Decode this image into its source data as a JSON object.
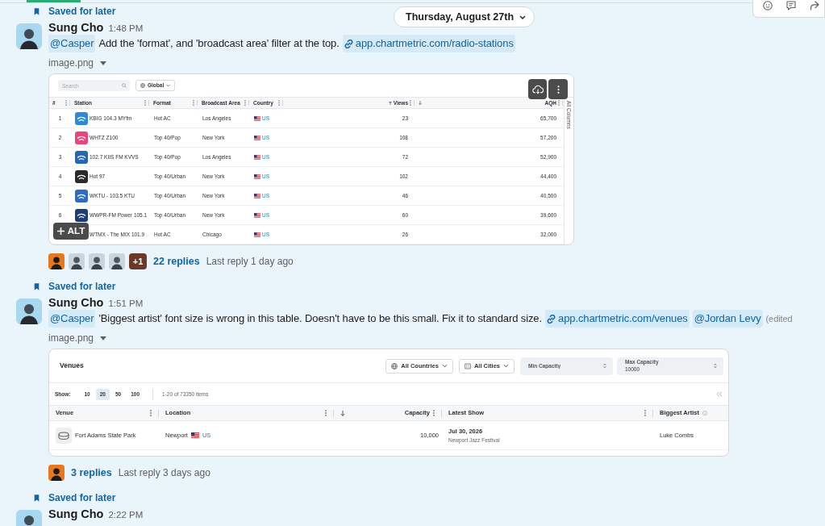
{
  "date_divider": {
    "label": "Thursday, August 27th"
  },
  "messages": [
    {
      "saved_label": "Saved for later",
      "author": "Sung Cho",
      "time": "1:48 PM",
      "body": [
        {
          "kind": "mention",
          "text": "@Casper"
        },
        {
          "kind": "text",
          "text": "Add the 'format', and 'broadcast area' filter at the top."
        },
        {
          "kind": "link",
          "text": "app.chartmetric.com/radio-stations"
        }
      ],
      "file_name": "image.png",
      "attachment": {
        "kind": "radio_stations",
        "search": {
          "placeholder": "Search"
        },
        "region_filter": "Global",
        "columns": [
          {
            "label": "#",
            "kind": "index",
            "sorted": false,
            "filtered": false
          },
          {
            "label": "Station",
            "kind": "text",
            "sorted": false,
            "filtered": false
          },
          {
            "label": "Format",
            "kind": "text",
            "sorted": false,
            "filtered": false
          },
          {
            "label": "Broadcast Area",
            "kind": "text",
            "sorted": false,
            "filtered": false
          },
          {
            "label": "Country",
            "kind": "text",
            "sorted": false,
            "filtered": false
          },
          {
            "label": "Views",
            "kind": "number",
            "sorted": false,
            "filtered": true
          },
          {
            "label": "AQH",
            "kind": "number",
            "sorted": true,
            "filtered": false
          }
        ],
        "side_label": "All Columns",
        "rows": [
          {
            "num": "1",
            "station": "KBIG 104.3 MYfm",
            "color": "#2e8ad6",
            "format": "Hot AC",
            "area": "Los Angeles",
            "country": "US",
            "views": "23",
            "aqh": "65,700"
          },
          {
            "num": "2",
            "station": "WHTZ Z100",
            "color": "#e8457a",
            "format": "Top 40/Pop",
            "area": "New York",
            "country": "US",
            "views": "108",
            "aqh": "57,200"
          },
          {
            "num": "3",
            "station": "102.7 KIIS FM KVVS",
            "color": "#2467b5",
            "format": "Top 40/Pop",
            "area": "Los Angeles",
            "country": "US",
            "views": "72",
            "aqh": "52,900"
          },
          {
            "num": "4",
            "station": "Hot 97",
            "color": "#2a2a2a",
            "format": "Top 40/Urban",
            "area": "New York",
            "country": "US",
            "views": "102",
            "aqh": "44,400"
          },
          {
            "num": "5",
            "station": "WKTU - 103.5 KTU",
            "color": "#2f6bc4",
            "format": "Top 40/Urban",
            "area": "New York",
            "country": "US",
            "views": "46",
            "aqh": "40,500"
          },
          {
            "num": "6",
            "station": "WWPR-FM Power 105.1",
            "color": "#1e3d78",
            "format": "Top 40/Urban",
            "area": "New York",
            "country": "US",
            "views": "60",
            "aqh": "39,600"
          },
          {
            "station": "WTMX - The MIX 101.9",
            "format": "Hot AC",
            "area": "Chicago",
            "country": "US",
            "views": "26",
            "aqh": "32,000"
          }
        ],
        "alt_button": "ALT"
      },
      "thread": {
        "participants": [
          {
            "kind": "illustration"
          },
          {
            "kind": "photo"
          },
          {
            "kind": "photo"
          },
          {
            "kind": "photo"
          },
          {
            "kind": "overflow",
            "text": "+1"
          }
        ],
        "replies": "22 replies",
        "last_reply": "Last reply 1 day ago"
      }
    },
    {
      "saved_label": "Saved for later",
      "author": "Sung Cho",
      "time": "1:51 PM",
      "body": [
        {
          "kind": "mention",
          "text": "@Casper"
        },
        {
          "kind": "text",
          "text": "'Biggest artist' font size is wrong in this table. Doesn't have to be this small. Fix it to standard size."
        },
        {
          "kind": "link",
          "text": "app.chartmetric.com/venues"
        },
        {
          "kind": "mention",
          "text": "@Jordan Levy"
        },
        {
          "kind": "edited",
          "text": "(edited"
        }
      ],
      "file_name": "image.png",
      "attachment": {
        "kind": "venues",
        "title": "Venues",
        "country_filter": "All Countries",
        "city_filter": "All Cities",
        "min_capacity": {
          "placeholder": "Min Capacity"
        },
        "max_capacity": {
          "label": "Max Capacity",
          "value": "10000"
        },
        "page_size_label": "Show:",
        "page_sizes": [
          {
            "label": "10",
            "selected": false
          },
          {
            "label": "20",
            "selected": true
          },
          {
            "label": "50",
            "selected": false
          },
          {
            "label": "100",
            "selected": false
          }
        ],
        "item_range": "1-20 of 73350 items",
        "columns": [
          {
            "label": "Venue",
            "kind": "text",
            "sorted": false
          },
          {
            "label": "Location",
            "kind": "text",
            "sorted": false
          },
          {
            "label": "Capacity",
            "kind": "number",
            "sorted": true
          },
          {
            "label": "Latest Show",
            "kind": "text",
            "sorted": false
          },
          {
            "label": "Biggest Artist",
            "kind": "info",
            "sorted": false
          }
        ],
        "rows": [
          {
            "venue": "Fort Adams State Park",
            "city": "Newport",
            "country": "US",
            "capacity": "10,000",
            "show_date": "Jul 30, 2026",
            "show_name": "Newport Jazz Festival",
            "artist": "Luke Combs"
          }
        ]
      },
      "thread": {
        "participants": [
          {
            "kind": "illustration"
          }
        ],
        "replies": "3 replies",
        "last_reply": "Last reply 3 days ago"
      }
    },
    {
      "saved_label": "Saved for later",
      "author": "Sung Cho",
      "time": "2:22 PM"
    }
  ]
}
